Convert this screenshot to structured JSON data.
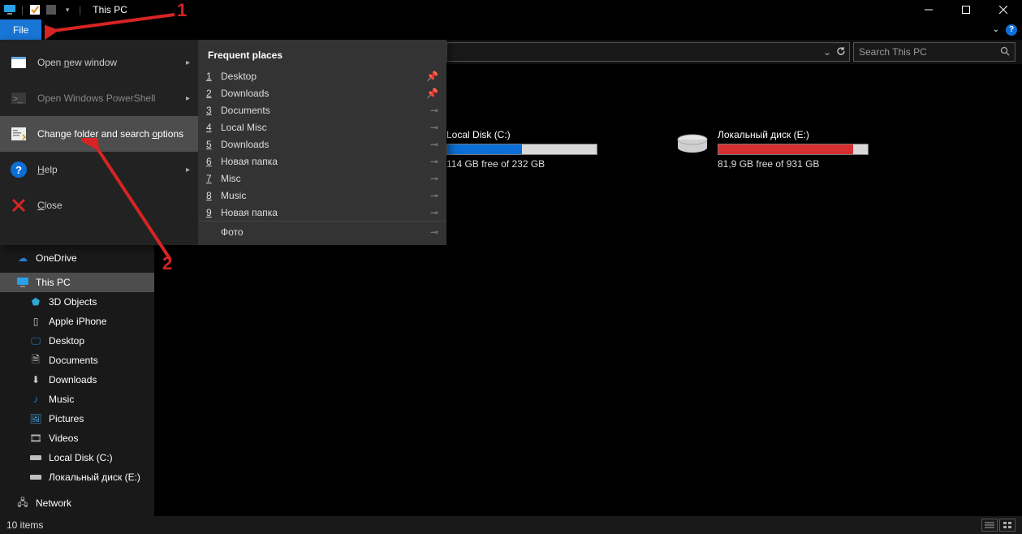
{
  "title": "This PC",
  "file_tab": "File",
  "search_placeholder": "Search This PC",
  "annotations": {
    "one": "1",
    "two": "2"
  },
  "file_menu": {
    "open_new_window": "Open new window",
    "open_ps": "Open Windows PowerShell",
    "change_options": "Change folder and search options",
    "help": "Help",
    "close": "Close",
    "freq_header": "Frequent places",
    "places": [
      {
        "n": "1",
        "label": "Desktop"
      },
      {
        "n": "2",
        "label": "Downloads"
      },
      {
        "n": "3",
        "label": "Documents"
      },
      {
        "n": "4",
        "label": "Local Misc"
      },
      {
        "n": "5",
        "label": "Downloads"
      },
      {
        "n": "6",
        "label": "Новая папка"
      },
      {
        "n": "7",
        "label": "Misc"
      },
      {
        "n": "8",
        "label": "Music"
      },
      {
        "n": "9",
        "label": "Новая папка"
      }
    ],
    "bottom_place": "Фото"
  },
  "sidebar": {
    "onedrive": "OneDrive",
    "thispc": "This PC",
    "obj3d": "3D Objects",
    "iphone": "Apple iPhone",
    "desktop": "Desktop",
    "documents": "Documents",
    "downloads": "Downloads",
    "music": "Music",
    "pictures": "Pictures",
    "videos": "Videos",
    "localc": "Local Disk (C:)",
    "locale": "Локальный диск (E:)",
    "network": "Network"
  },
  "drives": {
    "c": {
      "name": "Local Disk (C:)",
      "free": "114 GB free of 232 GB"
    },
    "e": {
      "name": "Локальный диск (E:)",
      "free": "81,9 GB free of 931 GB"
    }
  },
  "status": "10 items"
}
